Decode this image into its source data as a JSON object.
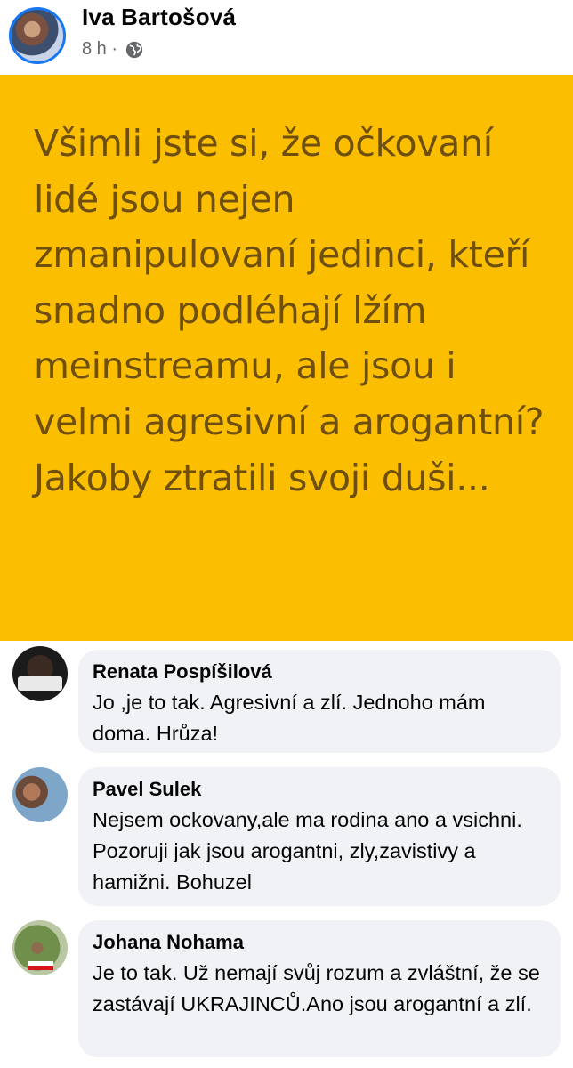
{
  "post": {
    "author": "Iva Bartošová",
    "time": "8 h ·",
    "privacy_icon": "globe-icon",
    "text": "Všimli jste si, že očkovaní lidé jsou nejen zmanipulovaní jedinci, kteří snadno podléhají lžím meinstreamu, ale jsou i velmi agresivní a arogantní? Jakoby ztratili svoji duši...",
    "background_color": "#fbbe00",
    "text_color": "#6e4f0e"
  },
  "comments": [
    {
      "author": "Renata Pospíšilová",
      "text": "Jo ,je to tak. Agresivní a zlí. Jednoho mám doma. Hrůza!"
    },
    {
      "author": "Pavel Sulek",
      "text": "Nejsem ockovany,ale ma rodina ano a vsichni. Pozoruji jak jsou arogantni, zly,zavistivy a hamižni. Bohuzel"
    },
    {
      "author": "Johana Nohama",
      "text": "Je to tak. Už nemají svůj rozum a zvláštní, že se zastávají UKRAJINCŮ.Ano jsou arogantní a zlí."
    }
  ]
}
